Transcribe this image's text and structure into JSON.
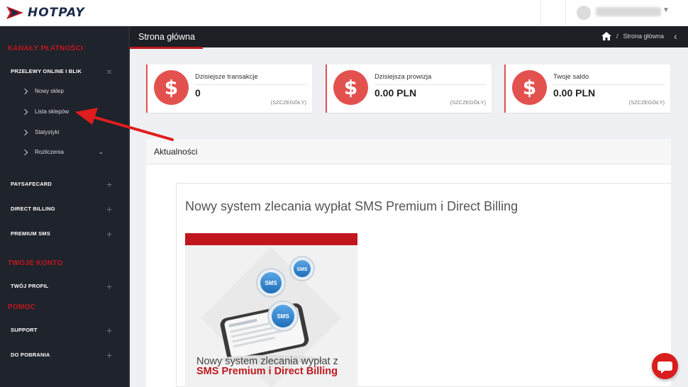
{
  "brand": {
    "name": "HOTPAY",
    "accent": "#c0171f",
    "dark": "#1f232b",
    "card_red": "#e3514f"
  },
  "sidebar": {
    "sections": [
      {
        "title": "KANAŁY PŁATNOŚCI"
      },
      {
        "title": "TWOJE KONTO"
      },
      {
        "title": "POMOC"
      }
    ],
    "groups": [
      {
        "label": "PRZELEWY ONLINE I BLIK",
        "icon": "close-icon"
      },
      {
        "label": "PAYSAFECARD",
        "icon": "plus-icon"
      },
      {
        "label": "DIRECT BILLING",
        "icon": "plus-icon"
      },
      {
        "label": "PREMIUM SMS",
        "icon": "plus-icon"
      },
      {
        "label": "TWÓJ PROFIL",
        "icon": "plus-icon"
      },
      {
        "label": "SUPPORT",
        "icon": "plus-icon"
      },
      {
        "label": "DO POBRANIA",
        "icon": "plus-icon"
      }
    ],
    "subitems": [
      {
        "label": "Nowy sklep"
      },
      {
        "label": "Lista sklepów"
      },
      {
        "label": "Statystyki"
      },
      {
        "label": "Rozliczenia",
        "icon": "chevron-down-icon"
      }
    ]
  },
  "header": {
    "page_title": "Strona główna",
    "breadcrumb": "Strona główna"
  },
  "cards": [
    {
      "label": "Dzisiejsze transakcje",
      "value": "0",
      "details": "(SZCZEGÓŁY)",
      "icon": "dollar-icon"
    },
    {
      "label": "Dzisiejsza prowizja",
      "value": "0.00 PLN",
      "details": "(SZCZEGÓŁY)",
      "icon": "dollar-icon"
    },
    {
      "label": "Twoje saldo",
      "value": "0.00 PLN",
      "details": "(SZCZEGÓŁY)",
      "icon": "dollar-icon"
    }
  ],
  "news": {
    "title": "Aktualności",
    "article_title": "Nowy system zlecania wypłat SMS Premium i Direct Billing",
    "promo": {
      "line1": "Nowy system zlecania wypłat z",
      "line2": "SMS Premium i Direct Billing",
      "bubble_label": "SMS"
    }
  }
}
